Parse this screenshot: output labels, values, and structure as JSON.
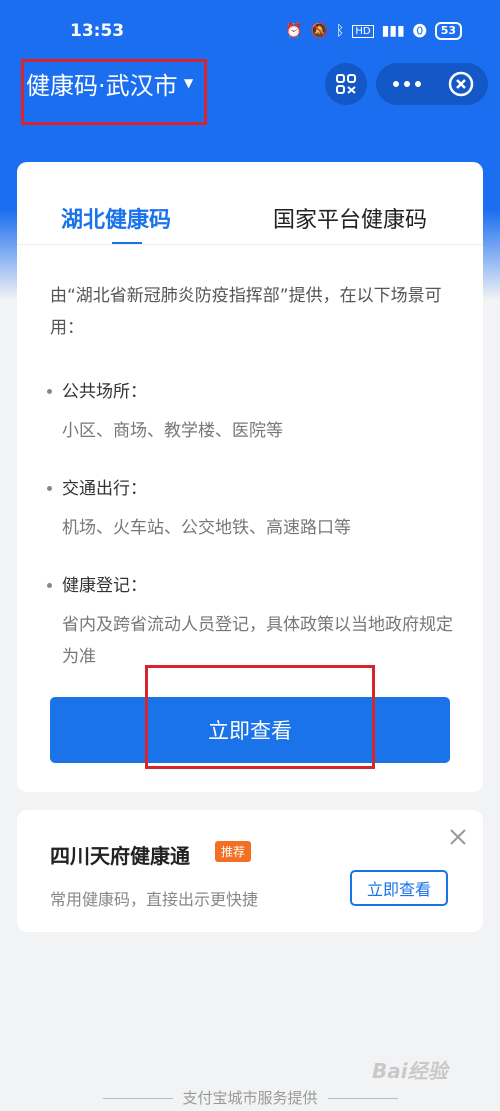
{
  "status_bar": {
    "time": "13:53",
    "battery": "53"
  },
  "header": {
    "title": "健康码·武汉市"
  },
  "tabs": [
    {
      "label": "湖北健康码"
    },
    {
      "label": "国家平台健康码"
    }
  ],
  "card": {
    "intro": "由“湖北省新冠肺炎防疫指挥部”提供，在以下场景可用：",
    "sections": [
      {
        "title": "公共场所：",
        "desc": "小区、商场、教学楼、医院等"
      },
      {
        "title": "交通出行：",
        "desc": "机场、火车站、公交地铁、高速路口等"
      },
      {
        "title": "健康登记：",
        "desc": "省内及跨省流动人员登记，具体政策以当地政府规定为准"
      }
    ],
    "button_label": "立即查看"
  },
  "promo": {
    "title": "四川天府健康通",
    "badge": "推荐",
    "desc": "常用健康码，直接出示更快捷",
    "button_label": "立即查看"
  },
  "footer": {
    "text": "支付宝城市服务提供"
  },
  "watermark": "Bai经验",
  "colors": {
    "brand_blue": "#1a73e8",
    "badge_orange": "#f36f24",
    "highlight_red": "#d8242e"
  }
}
